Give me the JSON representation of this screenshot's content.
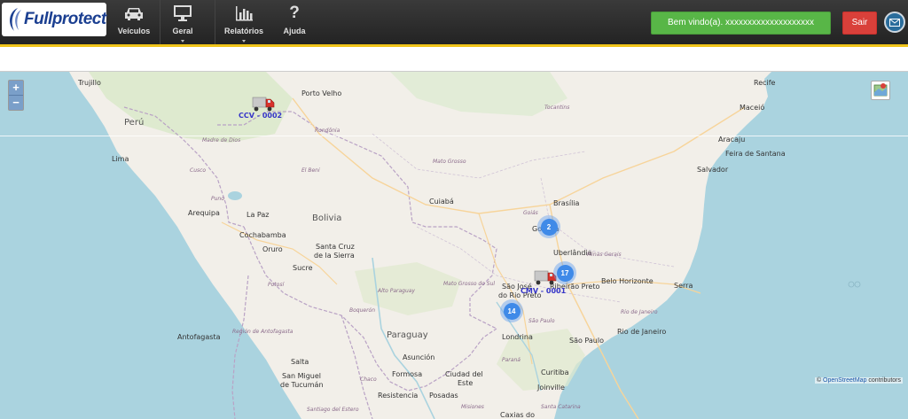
{
  "brand": {
    "name": "Fullprotect"
  },
  "nav": {
    "items": [
      {
        "label": "Veículos",
        "icon": "car-icon"
      },
      {
        "label": "Geral",
        "icon": "monitor-icon"
      },
      {
        "label": "Relatórios",
        "icon": "bar-chart-icon"
      },
      {
        "label": "Ajuda",
        "icon": "question-icon"
      }
    ]
  },
  "user": {
    "welcome": "Bem vindo(a). xxxxxxxxxxxxxxxxxxxx",
    "logout": "Sair"
  },
  "map": {
    "zoom_in": "+",
    "zoom_out": "−",
    "attribution_prefix": "© ",
    "attribution_link": "OpenStreetMap",
    "attribution_suffix": " contributors",
    "clusters": [
      {
        "count": "2"
      },
      {
        "count": "17"
      },
      {
        "count": "14"
      }
    ],
    "vehicles": [
      {
        "plate": "CCV - 0002"
      },
      {
        "plate": "CMV - 0001"
      }
    ],
    "countries": [
      "Perú",
      "Bolivia",
      "Paraguay"
    ],
    "cities": [
      "Trujillo",
      "Porto Velho",
      "Recife",
      "Maceió",
      "Lima",
      "Aracaju",
      "Salvador",
      "Feira de Santana",
      "Brasília",
      "Cuiabá",
      "Arequipa",
      "La Paz",
      "Cochabamba",
      "Oruro",
      "Santa Cruz",
      "de la Sierra",
      "Sucre",
      "Uberlândia",
      "Belo Horizonte",
      "Serra",
      "São José",
      "do Rio Preto",
      "Londrina",
      "São Paulo",
      "Rio de Janeiro",
      "Antofagasta",
      "Salta",
      "Asunción",
      "Formosa",
      "Resistencia",
      "Posadas",
      "Ciudad del",
      "Este",
      "Curitiba",
      "Joinville",
      "San Miguel",
      "de Tucumán",
      "Goiânia",
      "Ribeirão Preto",
      "Caxias do"
    ],
    "regions": [
      "Rondônia",
      "Tocantins",
      "Mato Grosso",
      "Goiás",
      "Minas Gerais",
      "Mato Grosso do Sul",
      "Alto Paraguay",
      "Boquerón",
      "Madre de Dios",
      "Cusco",
      "Puno",
      "Potosí",
      "Región de Antofagasta",
      "El Beni",
      "São Paulo",
      "Rio de Janeiro",
      "Paraná",
      "Santa Catarina",
      "Misiones",
      "Chaco",
      "Santiago del Estero"
    ]
  }
}
